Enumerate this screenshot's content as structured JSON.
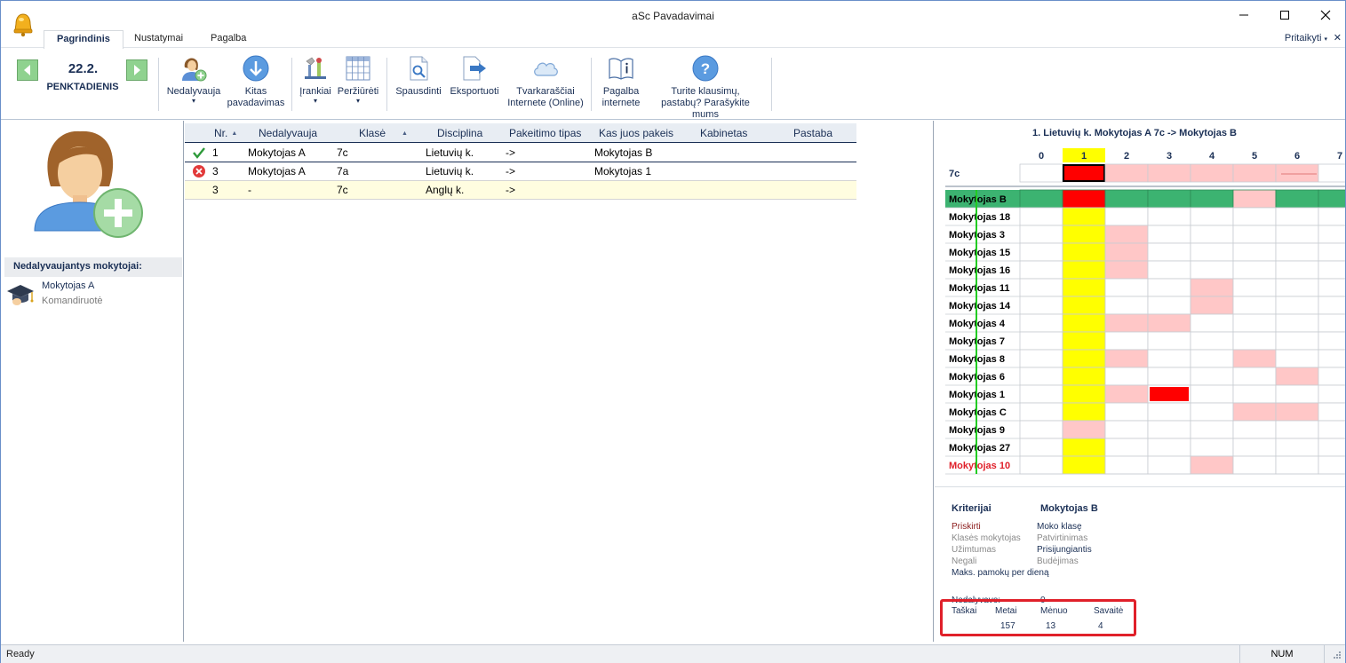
{
  "window": {
    "title": "aSc Pavadavimai"
  },
  "tabs": [
    {
      "label": "Pagrindinis",
      "active": true
    },
    {
      "label": "Nustatymai",
      "active": false
    },
    {
      "label": "Pagalba",
      "active": false
    }
  ],
  "customize_label": "Pritaikyti",
  "ribbon": {
    "date": "22.2.",
    "day": "PENKTADIENIS",
    "buttons": {
      "absent": "Nedalyvauja",
      "next_1": "Kitas",
      "next_2": "pavadavimas",
      "tools": "Įrankiai",
      "view": "Peržiūrėti",
      "print": "Spausdinti",
      "export": "Eksportuoti",
      "online_1": "Tvarkaraščiai",
      "online_2": "Internete (Online)",
      "help_1": "Pagalba",
      "help_2": "internete",
      "questions_1": "Turite klausimų,",
      "questions_2": "pastabų? Parašykite mums"
    }
  },
  "left_panel": {
    "header": "Nedalyvaujantys mokytojai:",
    "absent_teacher": "Mokytojas A",
    "absent_reason": "Komandiruotė"
  },
  "table": {
    "columns": {
      "nr": "Nr.",
      "absent": "Nedalyvauja",
      "class": "Klasė",
      "subject": "Disciplina",
      "type": "Pakeitimo tipas",
      "replacement": "Kas juos pakeis",
      "room": "Kabinetas",
      "note": "Pastaba"
    },
    "rows": [
      {
        "status": "ok",
        "nr": "1",
        "absent": "Mokytojas A",
        "class": "7c",
        "subject": "Lietuvių k.",
        "type": "->",
        "replacement": "Mokytojas B",
        "room": "",
        "note": ""
      },
      {
        "status": "error",
        "nr": "3",
        "absent": "Mokytojas A",
        "class": "7a",
        "subject": "Lietuvių k.",
        "type": "->",
        "replacement": "Mokytojas 1",
        "room": "",
        "note": ""
      },
      {
        "status": "none",
        "nr": "3",
        "absent": "-",
        "class": "7c",
        "subject": "Anglų k.",
        "type": "->",
        "replacement": "",
        "room": "",
        "note": ""
      }
    ]
  },
  "right_panel": {
    "title": "1. Lietuvių k. Mokytojas A 7c -> Mokytojas B",
    "periods": [
      "0",
      "1",
      "2",
      "3",
      "4",
      "5",
      "6",
      "7"
    ],
    "selected_period": "1",
    "class_row_label": "7c",
    "class_row_cells": [
      "empty",
      "selected-red",
      "pink",
      "pink",
      "pink",
      "pink",
      "pink",
      "empty"
    ],
    "teachers": [
      {
        "name": "Mokytojas B",
        "style": "highlight",
        "cells": [
          "green",
          "red",
          "green",
          "green",
          "green",
          "pink",
          "green",
          "green"
        ]
      },
      {
        "name": "Mokytojas 18",
        "style": "normal",
        "cells": [
          "empty",
          "yellow",
          "empty",
          "empty",
          "empty",
          "empty",
          "empty",
          "empty"
        ]
      },
      {
        "name": "Mokytojas 3",
        "style": "normal",
        "cells": [
          "empty",
          "yellow",
          "pink",
          "empty",
          "empty",
          "empty",
          "empty",
          "empty"
        ]
      },
      {
        "name": "Mokytojas 15",
        "style": "normal",
        "cells": [
          "empty",
          "yellow",
          "pink",
          "empty",
          "empty",
          "empty",
          "empty",
          "empty"
        ]
      },
      {
        "name": "Mokytojas 16",
        "style": "normal",
        "cells": [
          "empty",
          "yellow",
          "pink",
          "empty",
          "empty",
          "empty",
          "empty",
          "empty"
        ]
      },
      {
        "name": "Mokytojas 11",
        "style": "normal",
        "cells": [
          "empty",
          "yellow",
          "empty",
          "empty",
          "pink",
          "empty",
          "empty",
          "empty"
        ]
      },
      {
        "name": "Mokytojas 14",
        "style": "normal",
        "cells": [
          "empty",
          "yellow",
          "empty",
          "empty",
          "pink",
          "empty",
          "empty",
          "empty"
        ]
      },
      {
        "name": "Mokytojas 4",
        "style": "normal",
        "cells": [
          "empty",
          "yellow",
          "pink",
          "pink",
          "empty",
          "empty",
          "empty",
          "empty"
        ]
      },
      {
        "name": "Mokytojas 7",
        "style": "normal",
        "cells": [
          "empty",
          "yellow",
          "empty",
          "empty",
          "empty",
          "empty",
          "empty",
          "empty"
        ]
      },
      {
        "name": "Mokytojas 8",
        "style": "normal",
        "cells": [
          "empty",
          "yellow",
          "pink",
          "empty",
          "empty",
          "pink",
          "empty",
          "empty"
        ]
      },
      {
        "name": "Mokytojas 6",
        "style": "normal",
        "cells": [
          "empty",
          "yellow",
          "empty",
          "empty",
          "empty",
          "empty",
          "pink",
          "empty"
        ]
      },
      {
        "name": "Mokytojas 1",
        "style": "normal",
        "cells": [
          "empty",
          "yellow",
          "pink",
          "red",
          "empty",
          "empty",
          "empty",
          "empty"
        ]
      },
      {
        "name": "Mokytojas C",
        "style": "normal",
        "cells": [
          "empty",
          "yellow",
          "empty",
          "empty",
          "empty",
          "pink",
          "pink",
          "empty"
        ]
      },
      {
        "name": "Mokytojas 9",
        "style": "normal",
        "cells": [
          "empty",
          "pink",
          "empty",
          "empty",
          "empty",
          "empty",
          "empty",
          "empty"
        ]
      },
      {
        "name": "Mokytojas 27",
        "style": "normal",
        "cells": [
          "empty",
          "yellow",
          "empty",
          "empty",
          "empty",
          "empty",
          "empty",
          "empty"
        ]
      },
      {
        "name": "Mokytojas 10",
        "style": "red-name",
        "cells": [
          "empty",
          "yellow",
          "empty",
          "empty",
          "pink",
          "empty",
          "empty",
          "empty"
        ]
      }
    ],
    "criteria": {
      "header_left": "Kriterijai",
      "header_right": "Mokytojas B",
      "left": [
        {
          "text": "Priskirti",
          "color": "#8b1a1a"
        },
        {
          "text": "Klasės mokytojas",
          "color": "#8a8a8a"
        },
        {
          "text": "Užimtumas",
          "color": "#8a8a8a"
        },
        {
          "text": "Negali",
          "color": "#8a8a8a"
        },
        {
          "text": "Maks. pamokų per dieną",
          "color": "#1a2f55"
        }
      ],
      "right": [
        {
          "text": "Moko klasę",
          "color": "#1a2f55"
        },
        {
          "text": "Patvirtinimas",
          "color": "#8a8a8a"
        },
        {
          "text": "Prisijungiantis",
          "color": "#1a2f55"
        },
        {
          "text": "Budėjimas",
          "color": "#8a8a8a"
        }
      ],
      "absent_label": "Nedalyvavo:",
      "absent_value": "0"
    },
    "scores": {
      "label": "Taškai",
      "year_label": "Metai",
      "month_label": "Mėnuo",
      "week_label": "Savaitė",
      "year": "157",
      "month": "13",
      "week": "4"
    }
  },
  "statusbar": {
    "text": "Ready",
    "num": "NUM"
  },
  "colors": {
    "pink": "#ffc7c7",
    "red": "#ff0000",
    "green": "#3cb371",
    "yellow": "#ffff00",
    "nav": "#1a2f55"
  }
}
